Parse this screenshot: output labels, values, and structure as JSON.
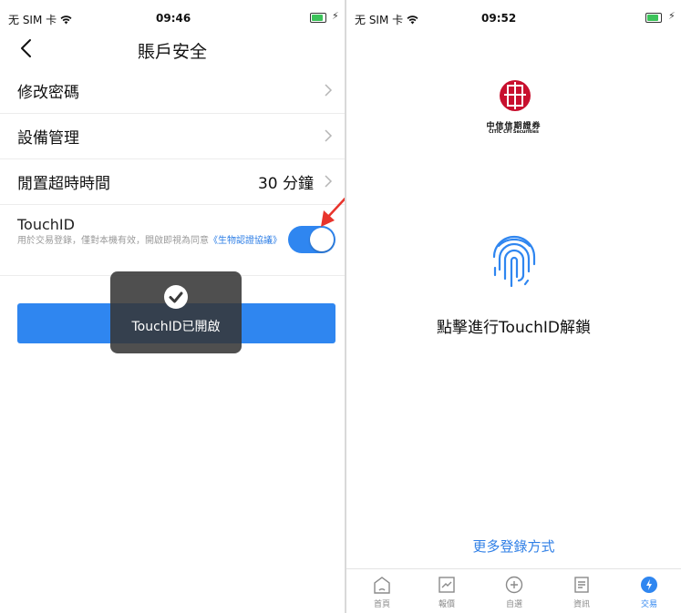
{
  "left_screen": {
    "status_bar": {
      "carrier": "无 SIM 卡",
      "time": "09:46"
    },
    "nav": {
      "title": "賬戶安全"
    },
    "rows": [
      {
        "label": "修改密碼",
        "value": ""
      },
      {
        "label": "設備管理",
        "value": ""
      },
      {
        "label": "閒置超時時間",
        "value": "30 分鐘"
      }
    ],
    "touchid": {
      "title": "TouchID",
      "description": "用於交易登錄，僅對本機有效，開啟即視為同意",
      "agreement_link": "《生物認證協議》",
      "enabled": true
    },
    "toast": {
      "text": "TouchID已開啟"
    }
  },
  "right_screen": {
    "status_bar": {
      "carrier": "无 SIM 卡",
      "time": "09:52"
    },
    "logo": {
      "name_cn": "中信信期證券",
      "name_en": "CITIC CFI Securities"
    },
    "unlock_prompt": "點擊進行TouchID解鎖",
    "more_login": "更多登錄方式",
    "tabs": [
      {
        "label": "首頁",
        "icon": "home-icon"
      },
      {
        "label": "報價",
        "icon": "chart-icon"
      },
      {
        "label": "自選",
        "icon": "plus-circle-icon"
      },
      {
        "label": "資訊",
        "icon": "document-icon"
      },
      {
        "label": "交易",
        "icon": "trade-icon",
        "active": true
      }
    ]
  },
  "colors": {
    "accent": "#2f86f0",
    "link": "#2f7fe6",
    "arrow": "#e8342c",
    "logo_red": "#c8102e"
  }
}
